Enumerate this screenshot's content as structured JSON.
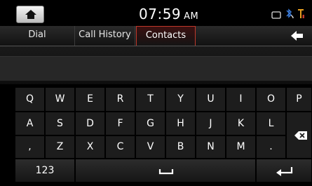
{
  "status": {
    "time": "07:59",
    "ampm": "AM"
  },
  "tabs": [
    {
      "label": "Dial",
      "active": false
    },
    {
      "label": "Call History",
      "active": false
    },
    {
      "label": "Contacts",
      "active": true
    }
  ],
  "keyboard": {
    "row1": [
      "Q",
      "W",
      "E",
      "R",
      "T",
      "Y",
      "U",
      "I",
      "O",
      "P"
    ],
    "row2": [
      "A",
      "S",
      "D",
      "F",
      "G",
      "H",
      "J",
      "K",
      "L"
    ],
    "row3": [
      ",",
      "Z",
      "X",
      "C",
      "V",
      "B",
      "N",
      "M",
      "."
    ],
    "numbers_label": "123"
  },
  "colors": {
    "accent": "#c0392b",
    "bluetooth": "#3b7ddd"
  }
}
